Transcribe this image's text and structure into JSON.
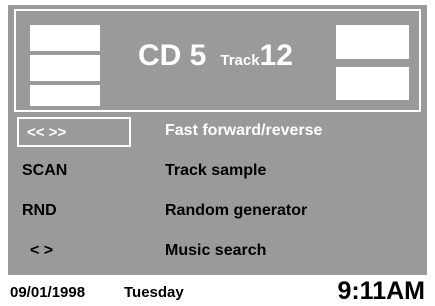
{
  "header": {
    "cd_label": "CD 5",
    "track_label": "Track",
    "track_number": "12"
  },
  "menu": [
    {
      "key": "<< >>",
      "description": "Fast forward/reverse",
      "selected": true
    },
    {
      "key": "SCAN",
      "description": "Track sample",
      "selected": false
    },
    {
      "key": "RND",
      "description": "Random generator",
      "selected": false
    },
    {
      "key": "< >",
      "description": "Music search",
      "selected": false
    }
  ],
  "status": {
    "date": "09/01/1998",
    "day": "Tuesday",
    "time": "9:11AM"
  },
  "colors": {
    "screen_bg": "#9a9a9a",
    "highlight_text": "#ffffff",
    "text": "#000000"
  }
}
